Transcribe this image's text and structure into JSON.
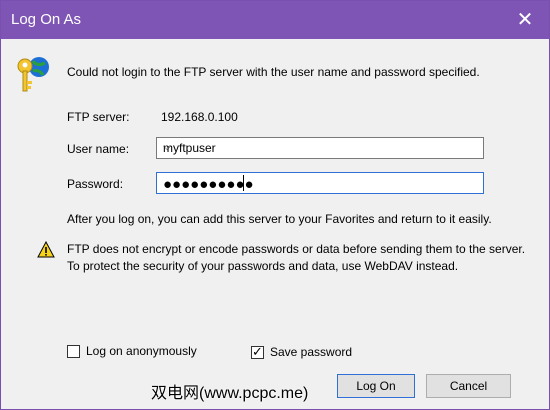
{
  "window": {
    "title": "Log On As"
  },
  "header": {
    "message": "Could not login to the FTP server with the user name and password specified."
  },
  "form": {
    "ftp_server_label": "FTP server:",
    "ftp_server_value": "192.168.0.100",
    "user_label": "User name:",
    "user_value": "myftpuser",
    "password_label": "Password:",
    "password_mask": "●●●●●●●●●●"
  },
  "info": {
    "text": "After you log on, you can add this server to your Favorites and return to it easily."
  },
  "warning": {
    "text": "FTP does not encrypt or encode passwords or data before sending them to the server.  To protect the security of your passwords and data, use WebDAV instead."
  },
  "options": {
    "anonymous_label": "Log on anonymously",
    "anonymous_checked": false,
    "save_password_label": "Save password",
    "save_password_checked": true
  },
  "buttons": {
    "logon": "Log On",
    "cancel": "Cancel"
  },
  "watermark": "双电网(www.pcpc.me)",
  "colors": {
    "titlebar": "#7e55b4",
    "focus": "#2f6fd6"
  },
  "icons": {
    "header": "keys-globe-icon",
    "warning": "warning-icon",
    "close": "close-icon",
    "dropdown": "chevron-down-icon"
  }
}
